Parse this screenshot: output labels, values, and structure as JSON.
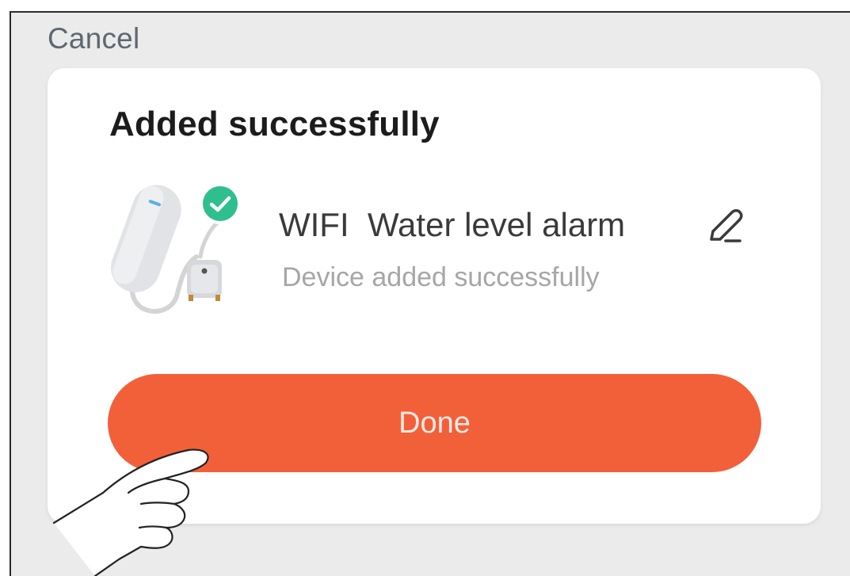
{
  "header": {
    "cancel_label": "Cancel"
  },
  "card": {
    "title": "Added successfully",
    "device": {
      "name": "WIFI  Water level alarm",
      "status": "Device added successfully",
      "image_icon": "water-level-sensor-icon",
      "check_icon": "check-circle-icon",
      "edit_icon": "pencil-icon"
    },
    "done_label": "Done"
  },
  "overlay": {
    "pointer_icon": "pointing-hand-icon"
  },
  "colors": {
    "accent": "#f2603a",
    "success": "#2fbf8f",
    "background": "#ebebeb",
    "card": "#ffffff"
  }
}
